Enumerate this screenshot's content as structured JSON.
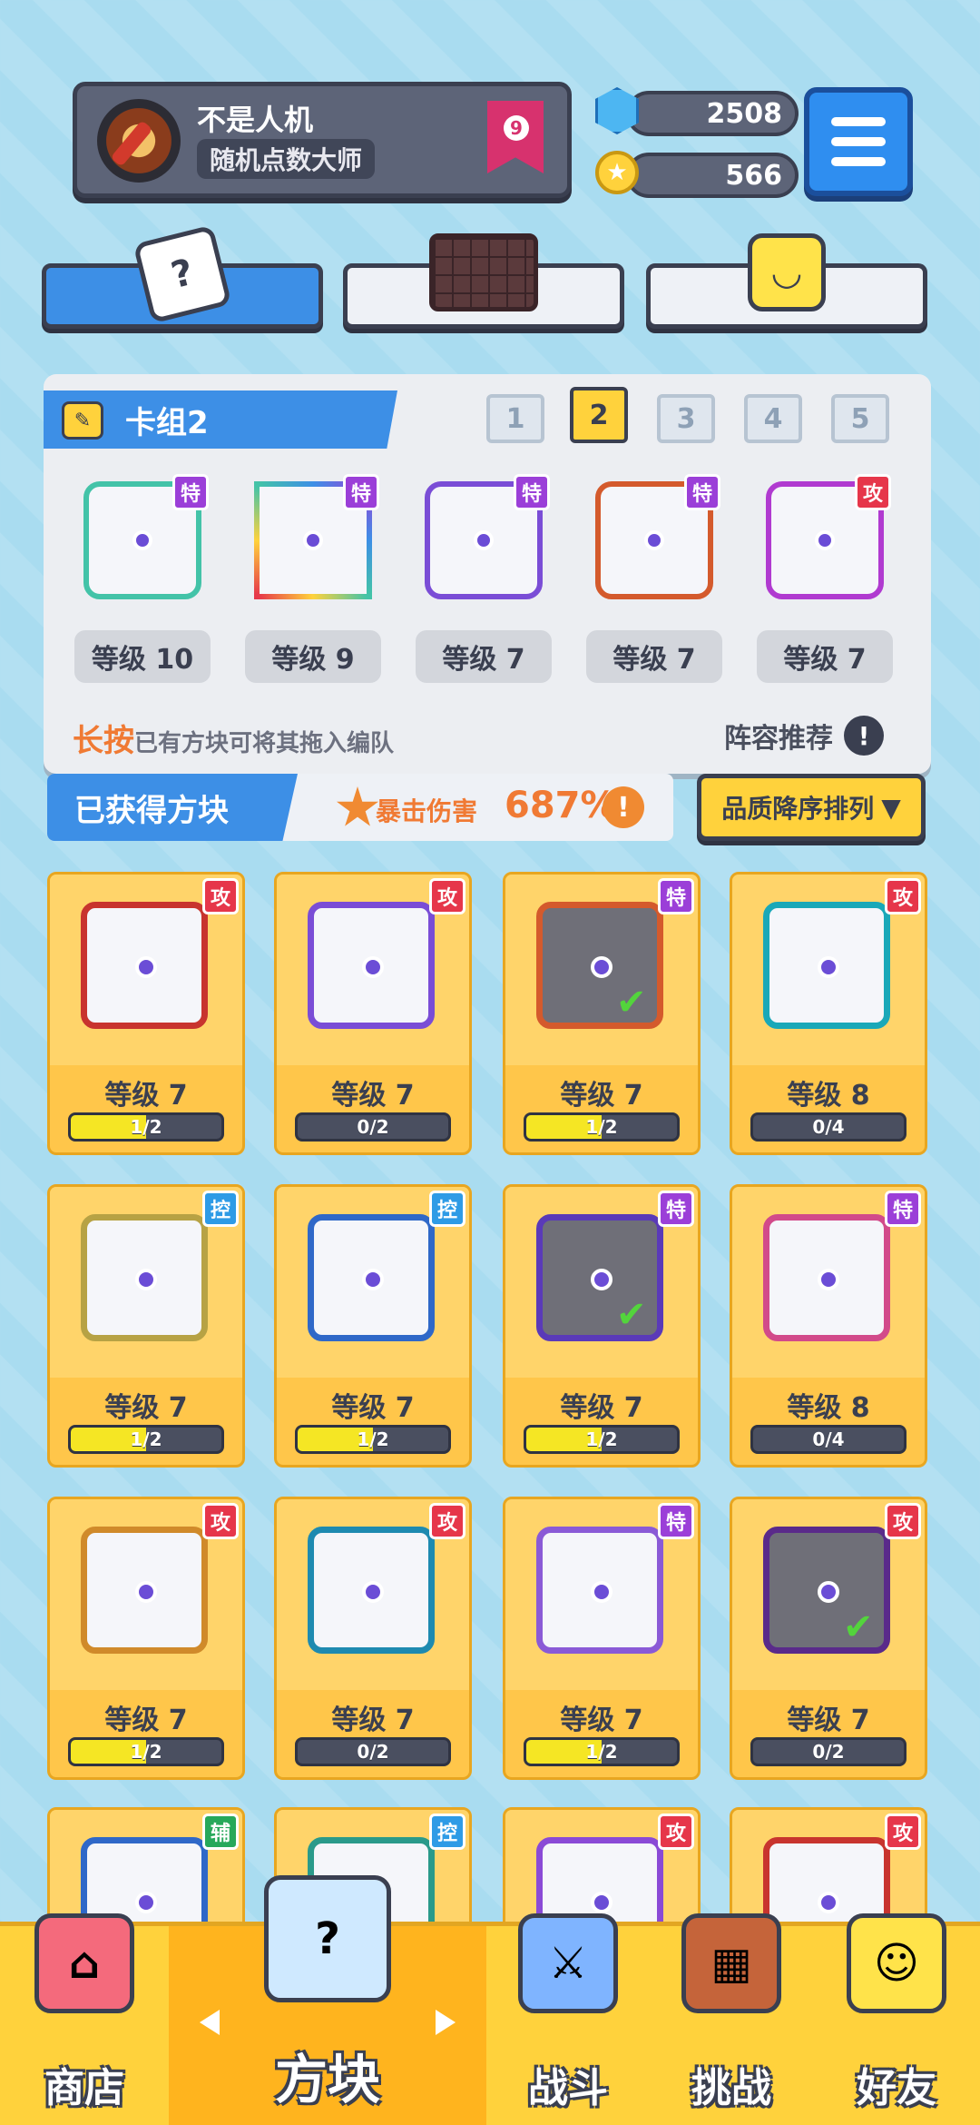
{
  "profile": {
    "username": "不是人机",
    "title": "随机点数大师",
    "rank": "9"
  },
  "currency": {
    "gems": "2508",
    "coins": "566"
  },
  "category_tabs": [
    {
      "name": "dice",
      "active": true
    },
    {
      "name": "board",
      "active": false
    },
    {
      "name": "emote",
      "active": false
    }
  ],
  "deck": {
    "label": "卡组2",
    "tabs": [
      "1",
      "2",
      "3",
      "4",
      "5"
    ],
    "active_tab": "2",
    "cards": [
      {
        "tag": "特",
        "level": "等级 10"
      },
      {
        "tag": "特",
        "level": "等级 9"
      },
      {
        "tag": "特",
        "level": "等级 7"
      },
      {
        "tag": "特",
        "level": "等级 7"
      },
      {
        "tag": "攻",
        "level": "等级 7"
      }
    ],
    "hint_highlight": "长按",
    "hint_text": "已有方块可将其拖入编队",
    "recommend": "阵容推荐"
  },
  "obtained": {
    "label": "已获得方块",
    "crit_label": "暴击伤害",
    "crit_value": "687%",
    "sort": "品质降序排列"
  },
  "inventory": [
    {
      "tag": "攻",
      "level": "等级 7",
      "progress": "1/2",
      "fill": 0.5
    },
    {
      "tag": "攻",
      "level": "等级 7",
      "progress": "0/2",
      "fill": 0
    },
    {
      "tag": "特",
      "level": "等级 7",
      "progress": "1/2",
      "fill": 0.5
    },
    {
      "tag": "攻",
      "level": "等级 8",
      "progress": "0/4",
      "fill": 0
    },
    {
      "tag": "控",
      "level": "等级 7",
      "progress": "1/2",
      "fill": 0.5
    },
    {
      "tag": "控",
      "level": "等级 7",
      "progress": "1/2",
      "fill": 0.5
    },
    {
      "tag": "特",
      "level": "等级 7",
      "progress": "1/2",
      "fill": 0.5
    },
    {
      "tag": "特",
      "level": "等级 8",
      "progress": "0/4",
      "fill": 0
    },
    {
      "tag": "攻",
      "level": "等级 7",
      "progress": "1/2",
      "fill": 0.5
    },
    {
      "tag": "攻",
      "level": "等级 7",
      "progress": "0/2",
      "fill": 0
    },
    {
      "tag": "特",
      "level": "等级 7",
      "progress": "1/2",
      "fill": 0.5
    },
    {
      "tag": "攻",
      "level": "等级 7",
      "progress": "0/2",
      "fill": 0
    },
    {
      "tag": "辅"
    },
    {
      "tag": "控"
    },
    {
      "tag": "攻"
    },
    {
      "tag": "攻"
    }
  ],
  "bottom_nav": [
    {
      "label": "商店",
      "icon": "shop-icon"
    },
    {
      "label": "方块",
      "icon": "dice-box-icon",
      "active": true
    },
    {
      "label": "战斗",
      "icon": "battle-icon"
    },
    {
      "label": "挑战",
      "icon": "challenge-icon"
    },
    {
      "label": "好友",
      "icon": "friends-icon"
    }
  ]
}
